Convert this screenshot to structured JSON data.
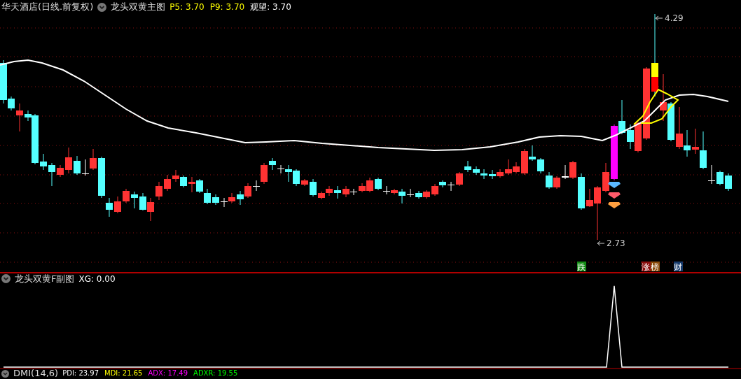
{
  "main_panel": {
    "title": "华天酒店(日线.前复权)",
    "indicator": "龙头双黄主图",
    "values": [
      {
        "label": "P5:",
        "value": "3.70",
        "color": "#ffff00"
      },
      {
        "label": "P9:",
        "value": "3.70",
        "color": "#ffff00"
      },
      {
        "label": "观望:",
        "value": "3.70",
        "color": "#ffffff"
      }
    ]
  },
  "price_labels": [
    {
      "kind": "high",
      "text": "4.29"
    },
    {
      "kind": "low",
      "text": "2.73"
    }
  ],
  "signal_tags": [
    {
      "text": "跌",
      "color": "#138a13"
    },
    {
      "text": "涨",
      "color": "#8b0d0d"
    },
    {
      "text": "榜",
      "color": "#8a4b0a"
    },
    {
      "text": "财",
      "color": "#163a6b"
    }
  ],
  "sub_panel": {
    "indicator": "龙头双黄F副图",
    "values": [
      {
        "label": "XG:",
        "value": "0.00",
        "color": "#ffffff"
      }
    ]
  },
  "dmi_panel": {
    "indicator": "DMI(14,6)",
    "values": [
      {
        "label": "PDI:",
        "value": "23.97",
        "color": "#ffffff"
      },
      {
        "label": "MDI:",
        "value": "21.65",
        "color": "#ffff00"
      },
      {
        "label": "ADX:",
        "value": "17.49",
        "color": "#ff00ff"
      },
      {
        "label": "ADXR:",
        "value": "19.55",
        "color": "#00ff00"
      }
    ]
  }
}
